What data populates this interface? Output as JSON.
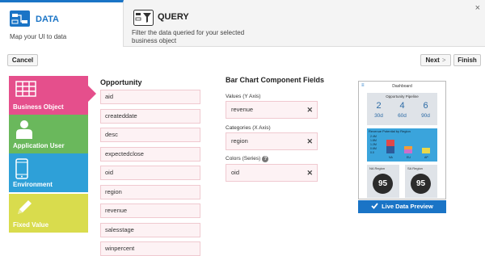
{
  "steps": [
    {
      "title": "DATA",
      "desc": "Map your UI to data",
      "icon": "data-mapping-icon"
    },
    {
      "title": "QUERY",
      "desc": "Filter the data queried for your selected business object",
      "icon": "query-filter-icon"
    }
  ],
  "close_label": "×",
  "toolbar": {
    "cancel": "Cancel",
    "next": "Next",
    "next_chevron": ">",
    "finish": "Finish"
  },
  "categories": [
    {
      "label": "Business Object",
      "color": "#e54f8c",
      "icon": "table-icon"
    },
    {
      "label": "Application User",
      "color": "#6ab85c",
      "icon": "user-icon"
    },
    {
      "label": "Environment",
      "color": "#2ea0d8",
      "icon": "mobile-device-icon"
    },
    {
      "label": "Fixed Value",
      "color": "#d9dc4d",
      "icon": "pencil-icon"
    }
  ],
  "fields_title": "Opportunity",
  "fields": [
    "aid",
    "createddate",
    "desc",
    "expectedclose",
    "oid",
    "region",
    "revenue",
    "salesstage",
    "winpercent"
  ],
  "component": {
    "title": "Bar Chart Component Fields",
    "values_label": "Values (Y Axis)",
    "values_value": "revenue",
    "categories_label": "Categories (X Axis)",
    "categories_value": "region",
    "colors_label": "Colors (Series)",
    "colors_value": "oid",
    "help": "?",
    "remove": "✕"
  },
  "preview": {
    "menu_icon": "≡",
    "header": "Dashboard",
    "pipeline_title": "Opportunity Pipeline",
    "pipeline": [
      {
        "num": "2",
        "label": "30d"
      },
      {
        "num": "4",
        "label": "60d"
      },
      {
        "num": "6",
        "label": "90d"
      }
    ],
    "revenue_title": "Revenue Potential by Region",
    "revenue_ticks": [
      "2.4M",
      "1.8M",
      "1.2M",
      "0.6M",
      "0.0"
    ],
    "revenue_regions": [
      "NA",
      "EU",
      "AP"
    ],
    "na_title": "NA Region",
    "na_value": "95",
    "sa_title": "SA Region",
    "sa_value": "95"
  },
  "live_preview": {
    "label": "Live Data Preview",
    "icon": "checkmark-icon"
  },
  "accent": "#1a74c6"
}
